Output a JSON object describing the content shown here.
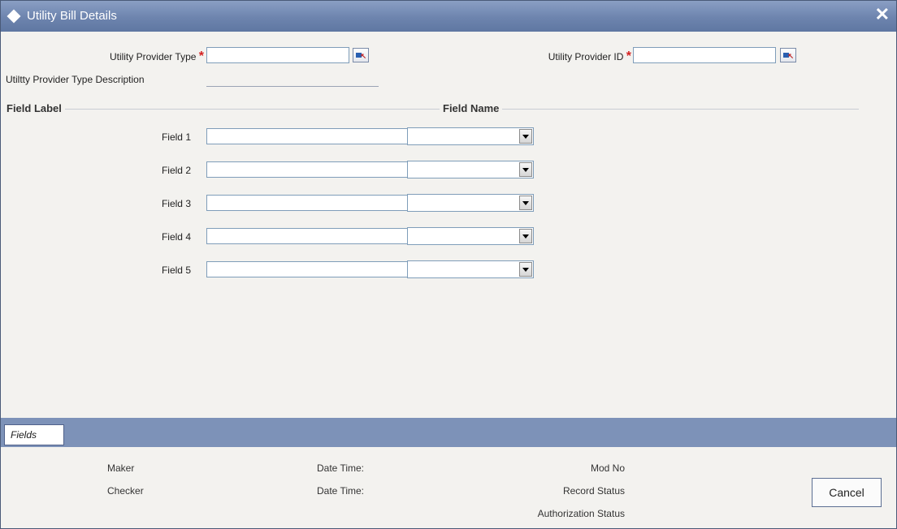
{
  "window": {
    "title": "Utility Bill Details"
  },
  "header": {
    "provider_type_label": "Utility Provider Type",
    "provider_type_value": "",
    "provider_id_label": "Utility Provider ID",
    "provider_id_value": "",
    "required_marker": "*",
    "type_description_label": "Utiltty Provider Type Description",
    "type_description_value": ""
  },
  "sections": {
    "field_label": "Field Label",
    "field_name": "Field Name"
  },
  "fields": [
    {
      "label": "Field 1",
      "value": "",
      "selected": ""
    },
    {
      "label": "Field 2",
      "value": "",
      "selected": ""
    },
    {
      "label": "Field 3",
      "value": "",
      "selected": ""
    },
    {
      "label": "Field 4",
      "value": "",
      "selected": ""
    },
    {
      "label": "Field 5",
      "value": "",
      "selected": ""
    }
  ],
  "tabs": {
    "fields": "Fields"
  },
  "footer": {
    "maker": "Maker",
    "checker": "Checker",
    "date_time_1": "Date Time:",
    "date_time_2": "Date Time:",
    "mod_no": "Mod No",
    "record_status": "Record Status",
    "authorization_status": "Authorization Status",
    "cancel": "Cancel"
  },
  "colors": {
    "titlebar": "#6d84ae",
    "required": "#d42020",
    "fieldbar": "#7d92b8",
    "lov_icon_blue": "#2a5fb0"
  },
  "icons": {
    "title": "diamond-icon",
    "close": "close-icon",
    "lov": "list-of-values-icon",
    "dropdown": "chevron-down-icon"
  }
}
